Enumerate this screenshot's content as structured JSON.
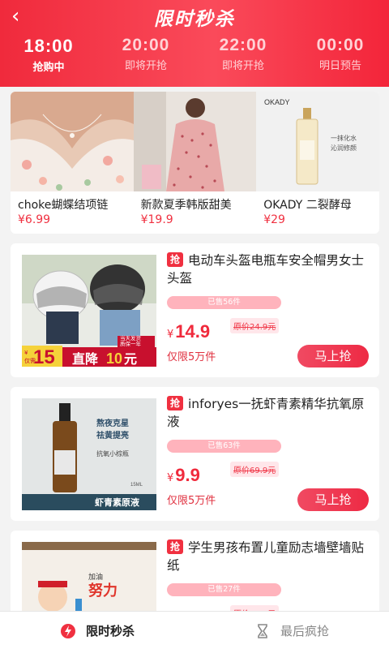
{
  "header": {
    "back_icon": "chevron-left-icon",
    "title": "限时秒杀",
    "slots": [
      {
        "time": "18:00",
        "status": "抢购中",
        "active": true
      },
      {
        "time": "20:00",
        "status": "即将开抢",
        "active": false
      },
      {
        "time": "22:00",
        "status": "即将开抢",
        "active": false
      },
      {
        "time": "00:00",
        "status": "明日预告",
        "active": false
      }
    ]
  },
  "featured": [
    {
      "name": "choke蝴蝶结项链",
      "price": "¥6.99"
    },
    {
      "name": "新款夏季韩版甜美",
      "price": "¥19.9"
    },
    {
      "name": "OKADY 二裂酵母",
      "price": "¥29",
      "image_text": {
        "brand": "OKADY",
        "caption": "一抹化水\n沁润修颜"
      }
    }
  ],
  "products": [
    {
      "tag": "抢",
      "name": "电动车头盔电瓶车安全帽男女士头盔",
      "sold": "已售56件",
      "currency": "¥",
      "price": "14.9",
      "original": "原价24.9元",
      "limit": "仅限5万件",
      "button": "马上抢",
      "image_text": {
        "badge": "当天发货",
        "badge2": "质保一年",
        "coupon_a": "¥",
        "coupon_b": "仅需",
        "coupon_num": "15",
        "coupon_label": "直降",
        "coupon_num2": "10",
        "coupon_unit": "元"
      }
    },
    {
      "tag": "抢",
      "name": "inforyes一抚虾青素精华抗氧原液",
      "sold": "已售63件",
      "currency": "¥",
      "price": "9.9",
      "original": "原价69.9元",
      "limit": "仅限5万件",
      "button": "马上抢",
      "image_text": {
        "line1": "熬夜克星",
        "line2": "祛黄提亮",
        "line3": "抗氧小棕瓶",
        "volume": "15ML",
        "footer": "虾青素原液"
      }
    },
    {
      "tag": "抢",
      "name": "学生男孩布置儿童励志墙壁墙贴纸",
      "sold": "已售27件",
      "currency": "¥",
      "price": "",
      "original": "原价9.90元",
      "limit": "",
      "button": "",
      "image_text": {
        "text1": "努力",
        "text2": "加油"
      }
    }
  ],
  "bottom_nav": [
    {
      "label": "限时秒杀",
      "icon": "lightning-icon",
      "active": true
    },
    {
      "label": "最后疯抢",
      "icon": "hourglass-icon",
      "active": false
    }
  ],
  "colors": {
    "accent": "#f02a3c",
    "price": "#f03040",
    "sold_bar": "#ffb3bc"
  }
}
